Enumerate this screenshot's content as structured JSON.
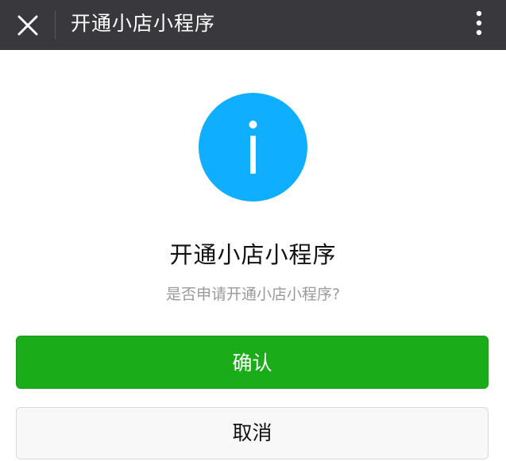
{
  "header": {
    "title": "开通小店小程序",
    "close_icon": "close-icon",
    "more_icon": "more-vertical-icon"
  },
  "dialog": {
    "icon": "info-icon",
    "heading": "开通小店小程序",
    "message": "是否申请开通小店小程序?",
    "confirm_label": "确认",
    "cancel_label": "取消"
  },
  "colors": {
    "topbar_bg": "#39393d",
    "info_blue": "#10aeff",
    "confirm_green": "#1aad19",
    "cancel_bg": "#f8f8f8"
  }
}
